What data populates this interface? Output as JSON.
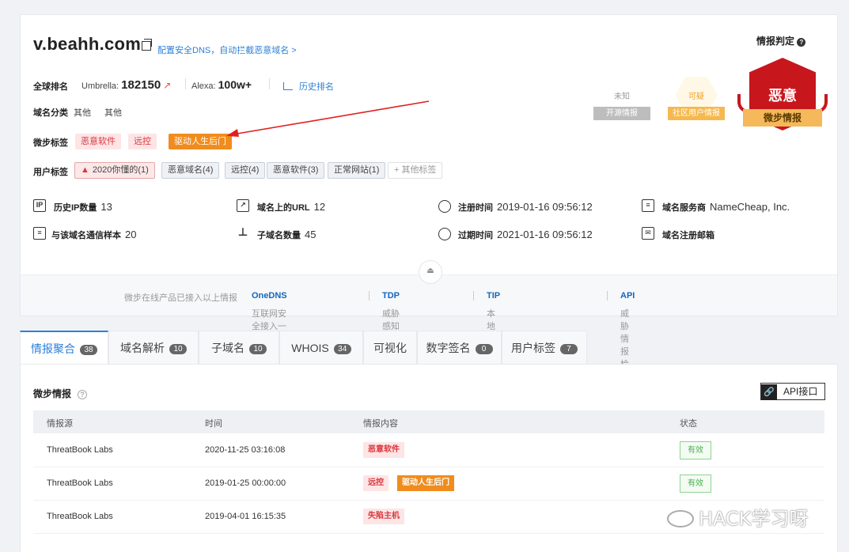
{
  "domain": {
    "name": "v.beahh.com",
    "dns_link": "配置安全DNS，自动拦截恶意域名 >"
  },
  "rank": {
    "label": "全球排名",
    "umbrella_label": "Umbrella:",
    "umbrella_value": "182150",
    "alexa_label": "Alexa:",
    "alexa_value": "100w+",
    "history_label": "历史排名"
  },
  "category": {
    "label": "域名分类",
    "values": [
      "其他",
      "其他"
    ]
  },
  "threat_tags": {
    "label": "微步标签",
    "items": [
      "恶意软件",
      "远控",
      "驱动人生后门"
    ]
  },
  "user_tags": {
    "label": "用户标签",
    "items": [
      "2020你懂的(1)",
      "恶意域名(4)",
      "远控(4)",
      "恶意软件(3)",
      "正常网站(1)"
    ],
    "more": "+ 其他标签"
  },
  "stats": {
    "history_ip": {
      "label": "历史IP数量",
      "value": "13"
    },
    "urls": {
      "label": "域名上的URL",
      "value": "12"
    },
    "reg_time": {
      "label": "注册时间",
      "value": "2019-01-16 09:56:12"
    },
    "registrar": {
      "label": "域名服务商",
      "value": "NameCheap, Inc."
    },
    "samples": {
      "label": "与该域名通信样本",
      "value": "20"
    },
    "subdomains": {
      "label": "子域名数量",
      "value": "45"
    },
    "exp_time": {
      "label": "过期时间",
      "value": "2021-01-16 09:56:12"
    },
    "reg_email": {
      "label": "域名注册邮箱",
      "value": ""
    }
  },
  "verdict": {
    "title": "情报判定",
    "unknown_label": "未知",
    "unknown_ribbon": "开源情报",
    "suspicious_label": "可疑",
    "suspicious_ribbon": "社区用户情报",
    "malicious_label": "恶意",
    "malicious_ribbon": "微步情报"
  },
  "footer": {
    "intro": "微步在线产品已接入以上情报",
    "link1_prefix": "互联网安全接入一 ",
    "link1_bold": "OneDNS",
    "link2_prefix": "威胁感知平台一 ",
    "link2_bold": "TDP",
    "link3_prefix": "本地威胁情报管理平台一 ",
    "link3_bold": "TIP",
    "link4_prefix": "威胁情报检测与分析一 ",
    "link4_bold": "API"
  },
  "tabs": [
    {
      "label": "情报聚合",
      "count": "38"
    },
    {
      "label": "域名解析",
      "count": "10"
    },
    {
      "label": "子域名",
      "count": "10"
    },
    {
      "label": "WHOIS",
      "count": "34"
    },
    {
      "label": "可视化",
      "count": ""
    },
    {
      "label": "数字签名",
      "count": "0"
    },
    {
      "label": "用户标签",
      "count": "7"
    }
  ],
  "intel": {
    "title": "微步情报",
    "api_button": "API接口",
    "headers": [
      "情报源",
      "时间",
      "情报内容",
      "状态"
    ],
    "rows": [
      {
        "source": "ThreatBook Labs",
        "time": "2020-11-25 03:16:08",
        "tags": [
          "恶意软件"
        ],
        "status": "有效"
      },
      {
        "source": "ThreatBook Labs",
        "time": "2019-01-25 00:00:00",
        "tags": [
          "远控",
          "驱动人生后门"
        ],
        "status": "有效"
      },
      {
        "source": "ThreatBook Labs",
        "time": "2019-04-01 16:15:35",
        "tags": [
          "失陷主机"
        ],
        "status": ""
      }
    ]
  },
  "watermark": "HACK学习呀",
  "colors": {
    "accent": "#2d7fd8",
    "danger": "#c8161d",
    "orange": "#f08c1d",
    "valid": "#4caf50"
  }
}
